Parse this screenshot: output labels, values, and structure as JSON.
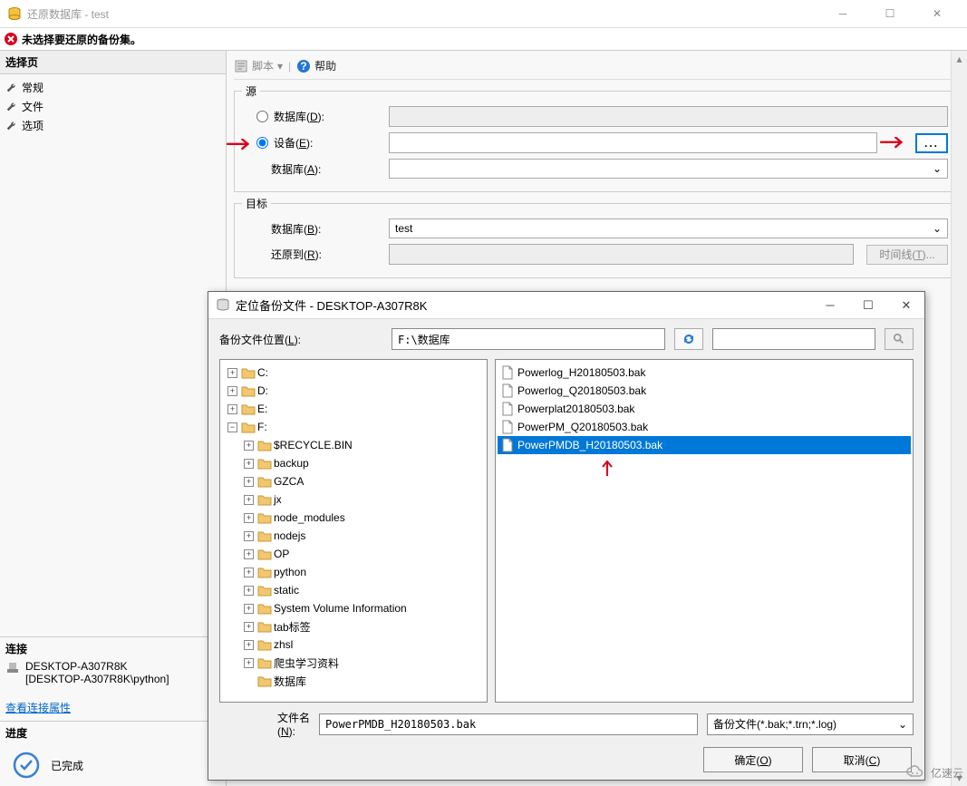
{
  "window": {
    "title": "还原数据库 - test"
  },
  "error_bar": {
    "message": "未选择要还原的备份集。"
  },
  "sidebar": {
    "select_page_title": "选择页",
    "items": [
      "常规",
      "文件",
      "选项"
    ],
    "connection_title": "连接",
    "server": "DESKTOP-A307R8K",
    "conn_string": "[DESKTOP-A307R8K\\python]",
    "view_props": "查看连接属性",
    "progress_title": "进度",
    "progress_status": "已完成"
  },
  "toolbar": {
    "script": "脚本",
    "help": "帮助"
  },
  "source": {
    "legend": "源",
    "database_radio": "数据库(D):",
    "device_radio": "设备(E):",
    "database_label": "数据库(A):"
  },
  "target": {
    "legend": "目标",
    "database_label": "数据库(B):",
    "database_value": "test",
    "restore_to_label": "还原到(R):",
    "timeline_btn": "时间线(T)..."
  },
  "dialog": {
    "title": "定位备份文件 - DESKTOP-A307R8K",
    "location_label": "备份文件位置(L):",
    "location_path": "F:\\数据库",
    "filename_label": "文件名(N):",
    "filename_value": "PowerPMDB_H20180503.bak",
    "filter": "备份文件(*.bak;*.trn;*.log)",
    "ok": "确定(O)",
    "cancel": "取消(C)"
  },
  "tree": {
    "drives": [
      "C:",
      "D:",
      "E:",
      "F:"
    ],
    "f_children": [
      "$RECYCLE.BIN",
      "backup",
      "GZCA",
      "jx",
      "node_modules",
      "nodejs",
      "OP",
      "python",
      "static",
      "System Volume Information",
      "tab标签",
      "zhsl",
      "爬虫学习资料",
      "数据库"
    ]
  },
  "files": {
    "items": [
      {
        "name": "Powerlog_H20180503.bak",
        "selected": false
      },
      {
        "name": "Powerlog_Q20180503.bak",
        "selected": false
      },
      {
        "name": "Powerplat20180503.bak",
        "selected": false
      },
      {
        "name": "PowerPM_Q20180503.bak",
        "selected": false
      },
      {
        "name": "PowerPMDB_H20180503.bak",
        "selected": true
      }
    ]
  },
  "watermark": "亿速云"
}
